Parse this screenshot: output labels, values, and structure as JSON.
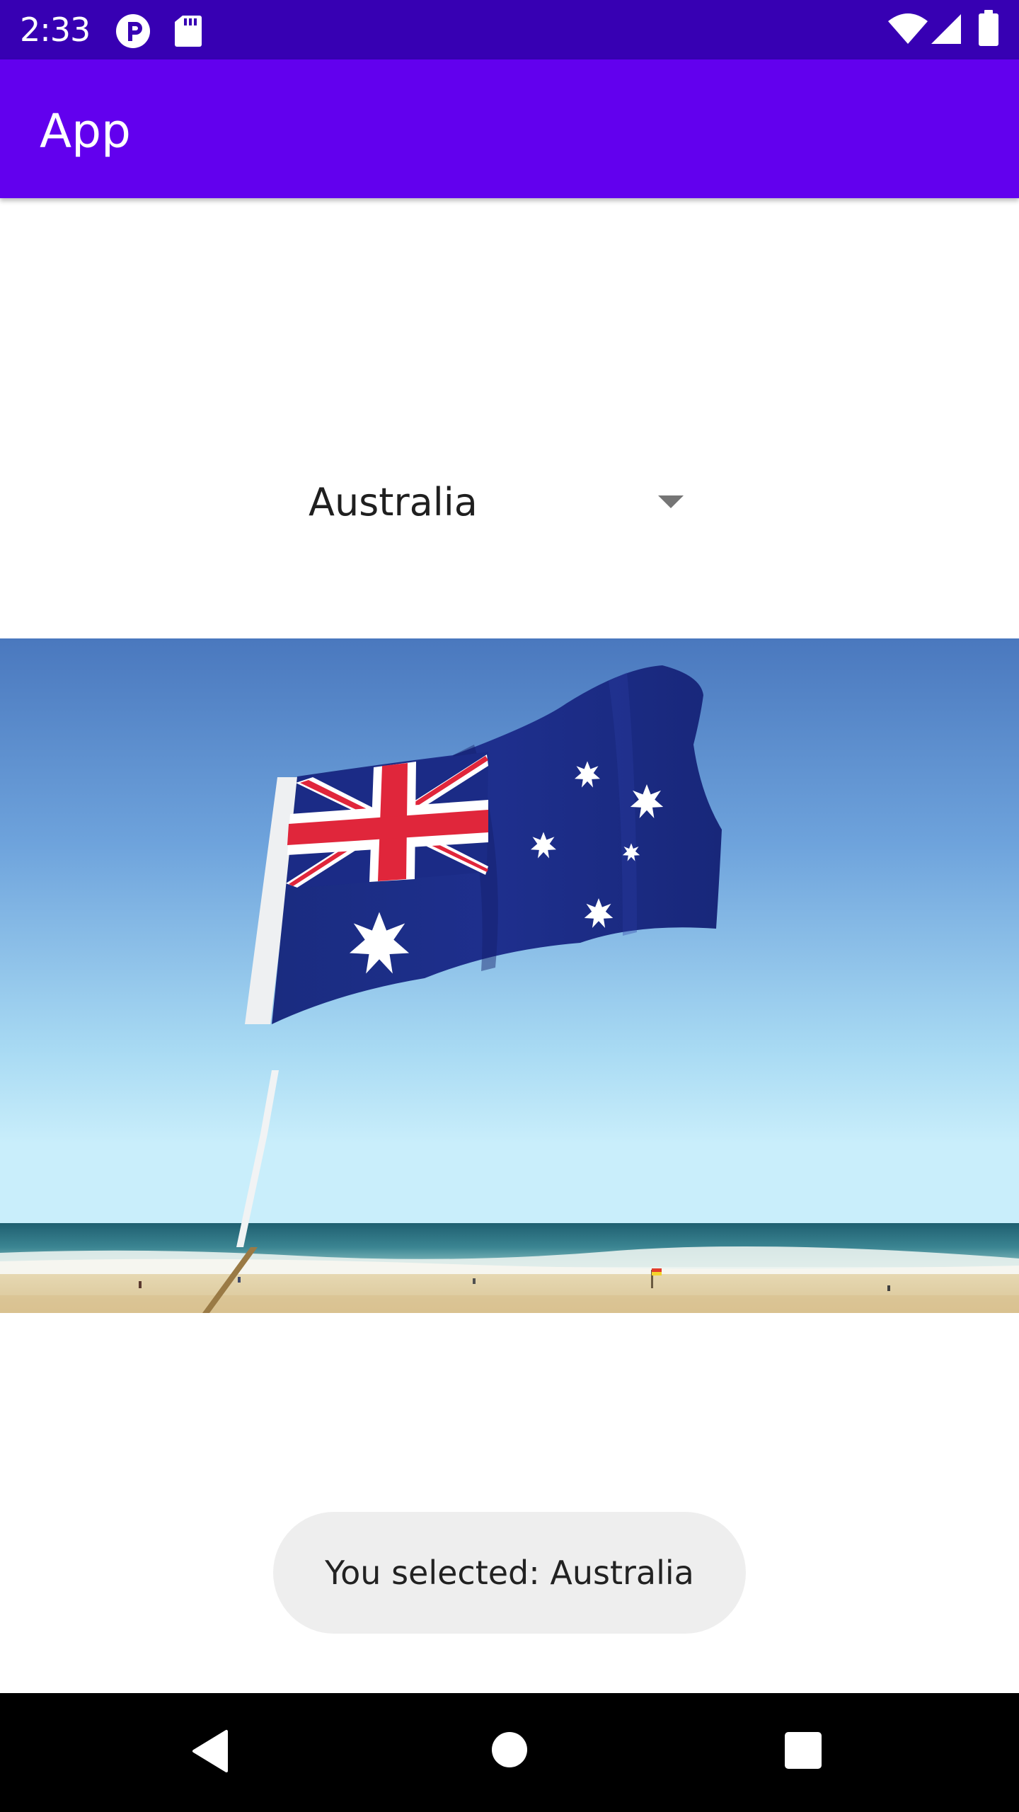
{
  "status_bar": {
    "time": "2:33",
    "background_color": "#3700b3",
    "icons": [
      "notification-p-icon",
      "sd-card-icon",
      "wifi-icon",
      "signal-icon",
      "battery-icon"
    ]
  },
  "app_bar": {
    "title": "App",
    "background_color": "#6200ee"
  },
  "spinner": {
    "selected_value": "Australia",
    "icon": "dropdown-arrow-icon"
  },
  "image": {
    "subject": "australian-flag-photo"
  },
  "toast": {
    "message": "You selected: Australia"
  },
  "nav_bar": {
    "buttons": [
      "back-icon",
      "home-icon",
      "recents-icon"
    ]
  }
}
